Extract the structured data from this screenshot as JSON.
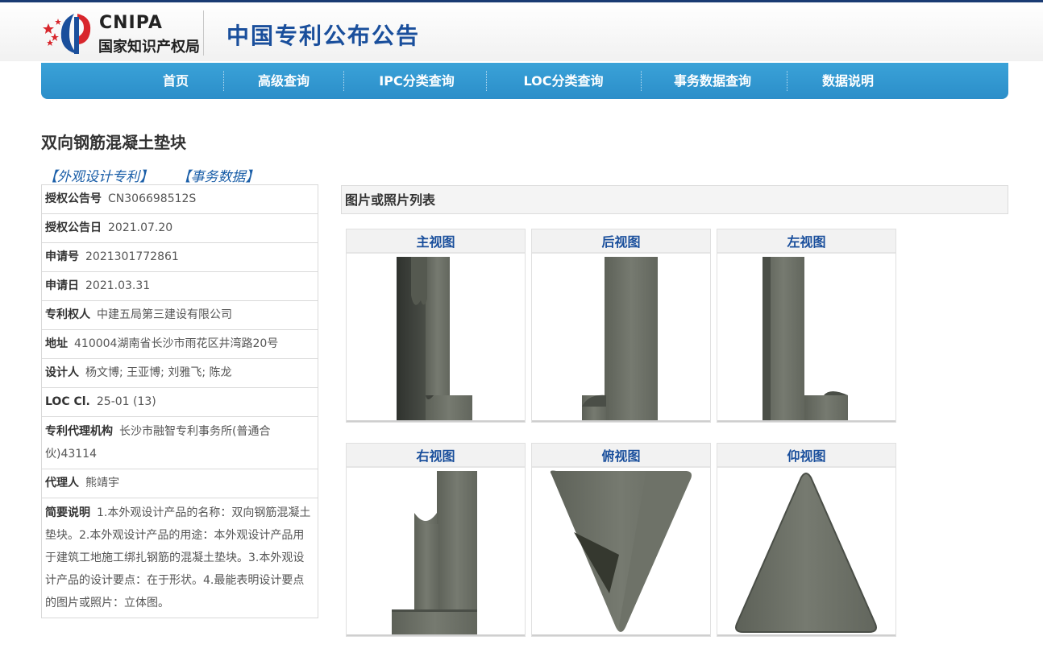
{
  "header": {
    "logo_en": "CNIPA",
    "logo_cn": "国家知识产权局",
    "site_title": "中国专利公布公告"
  },
  "nav": {
    "items": [
      "首页",
      "高级查询",
      "IPC分类查询",
      "LOC分类查询",
      "事务数据查询",
      "数据说明"
    ]
  },
  "page": {
    "title": "双向钢筋混凝土垫块",
    "links": [
      "【外观设计专利】",
      "【事务数据】"
    ]
  },
  "info": [
    {
      "key": "授权公告号",
      "value": "CN306698512S"
    },
    {
      "key": "授权公告日",
      "value": "2021.07.20"
    },
    {
      "key": "申请号",
      "value": "2021301772861"
    },
    {
      "key": "申请日",
      "value": "2021.03.31"
    },
    {
      "key": "专利权人",
      "value": "中建五局第三建设有限公司"
    },
    {
      "key": "地址",
      "value": "410004湖南省长沙市雨花区井湾路20号"
    },
    {
      "key": "设计人",
      "value": "杨文博; 王亚博; 刘雅飞; 陈龙"
    },
    {
      "key": "LOC Cl.",
      "value": "25-01 (13)"
    },
    {
      "key": "专利代理机构",
      "value": "长沙市融智专利事务所(普通合伙)43114"
    },
    {
      "key": "代理人",
      "value": "熊靖宇"
    },
    {
      "key": "简要说明",
      "value": "1.本外观设计产品的名称：双向钢筋混凝土垫块。2.本外观设计产品的用途：本外观设计产品用于建筑工地施工绑扎钢筋的混凝土垫块。3.本外观设计产品的设计要点：在于形状。4.最能表明设计要点的图片或照片：立体图。"
    }
  ],
  "photos": {
    "heading": "图片或照片列表",
    "views": [
      "主视图",
      "后视图",
      "左视图",
      "右视图",
      "俯视图",
      "仰视图"
    ]
  },
  "colors": {
    "nav": "#2b8ec9",
    "title_blue": "#1a4f9c",
    "link_blue": "#1a5ea8",
    "concrete": "#6b6f66"
  }
}
